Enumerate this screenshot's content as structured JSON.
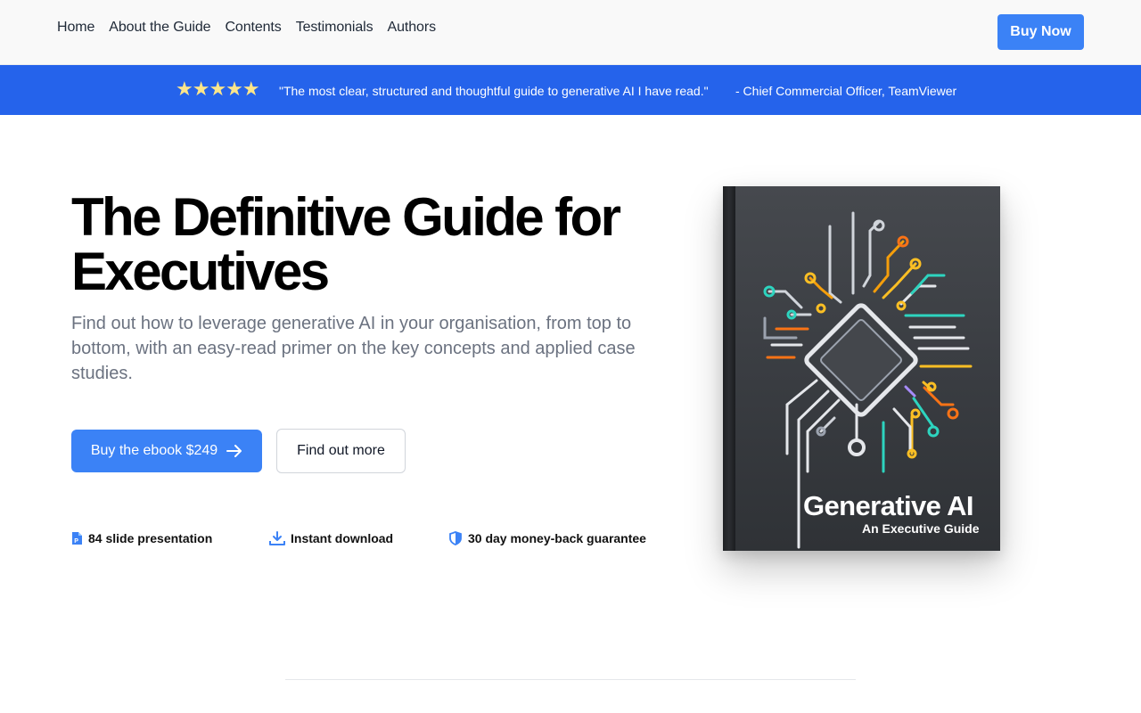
{
  "nav": {
    "links": [
      "Home",
      "About the Guide",
      "Contents",
      "Testimonials",
      "Authors"
    ],
    "buy_label": "Buy Now"
  },
  "banner": {
    "stars": "★★★★★",
    "quote": "\"The most clear, structured and thoughtful guide to generative AI I have read.\"",
    "author": "- Chief Commercial Officer, TeamViewer"
  },
  "hero": {
    "title": "The Definitive Guide for Executives",
    "subtitle": "Find out how to leverage generative AI in your organisation, from top to bottom, with an easy-read primer on the key concepts and applied case studies.",
    "primary_button": "Buy the ebook $249",
    "secondary_button": "Find out more",
    "features": [
      {
        "icon": "presentation-file-icon",
        "label": "84 slide presentation"
      },
      {
        "icon": "download-icon",
        "label": "Instant download"
      },
      {
        "icon": "shield-icon",
        "label": "30 day money-back guarantee"
      }
    ]
  },
  "book": {
    "title": "Generative AI",
    "subtitle": "An Executive Guide"
  },
  "colors": {
    "accent": "#3b82f6",
    "banner": "#2563eb",
    "stars": "#fde68a"
  }
}
